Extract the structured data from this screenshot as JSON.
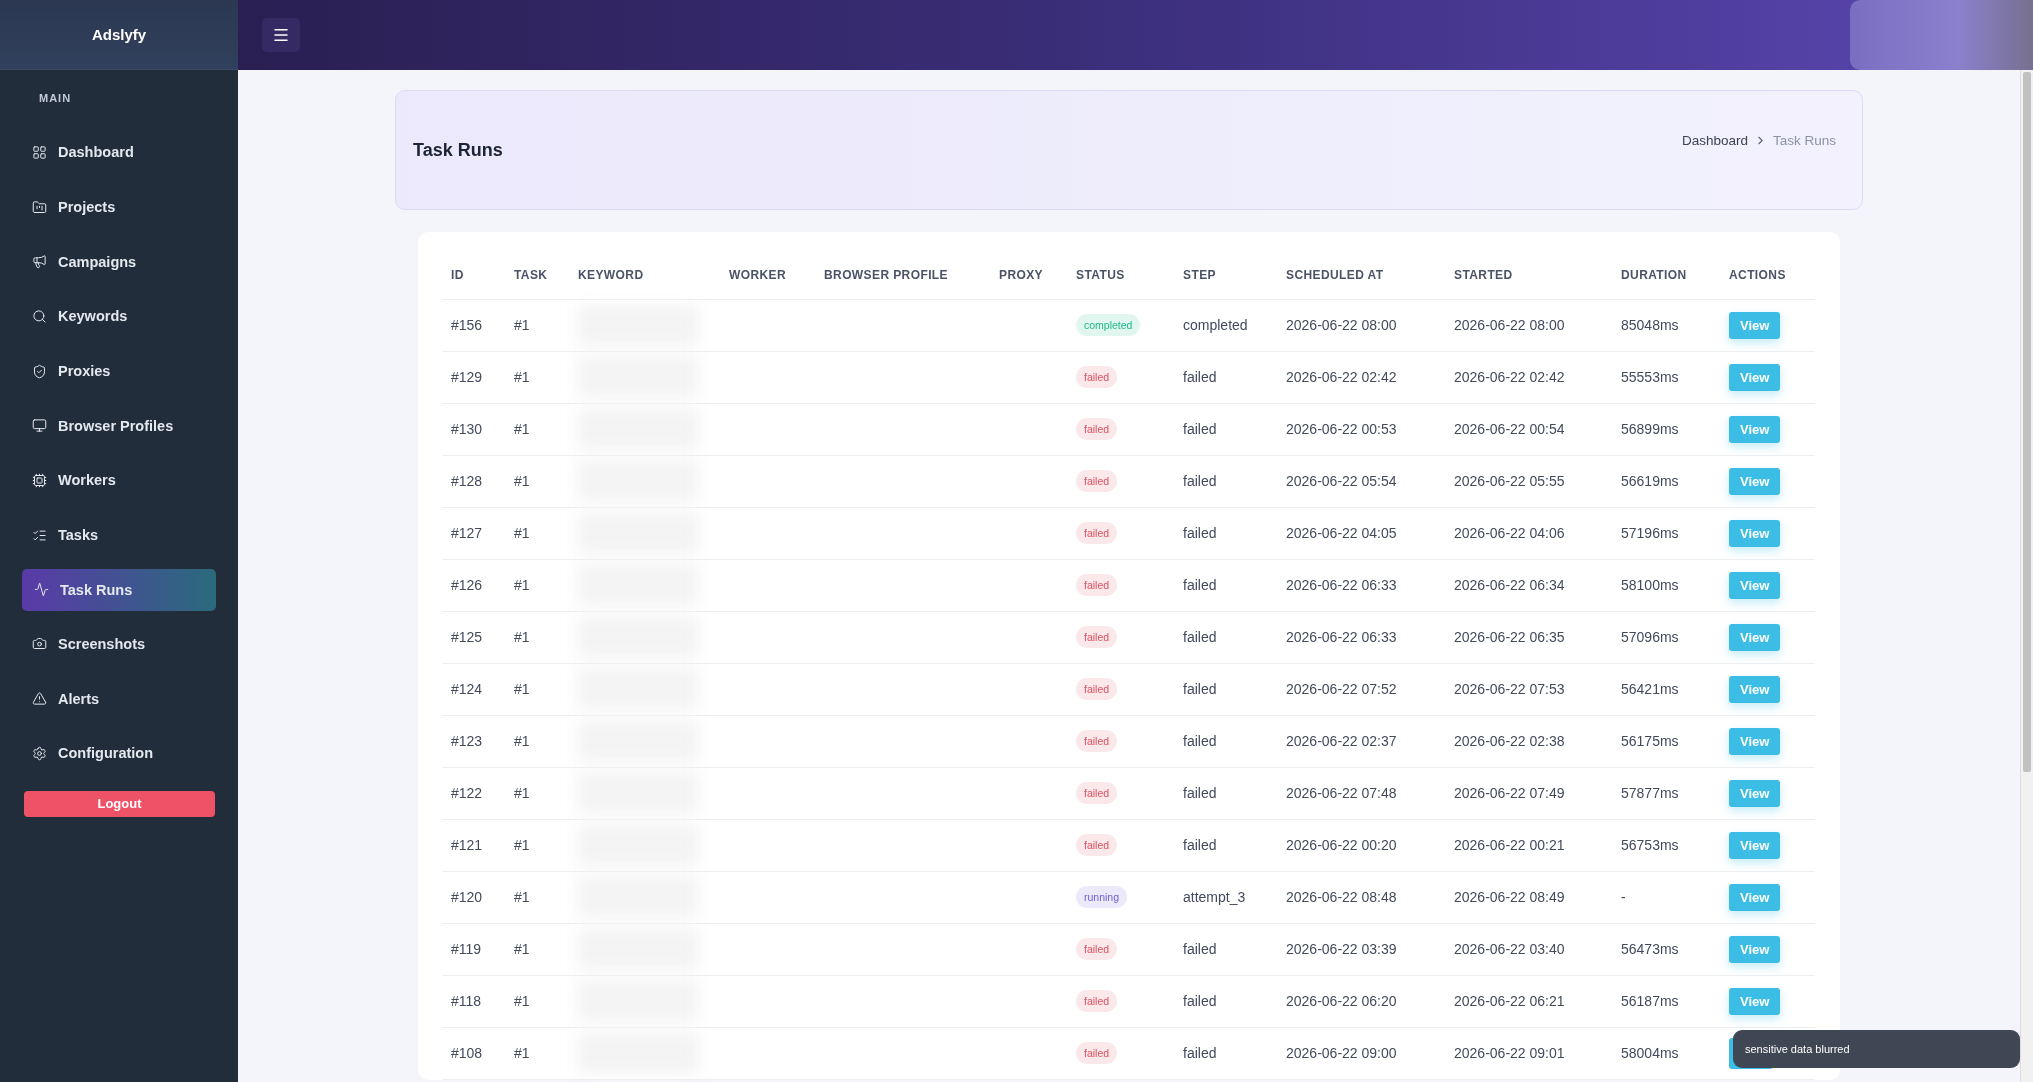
{
  "sidebar": {
    "brand": "Adslyfy",
    "section": "MAIN",
    "items": [
      {
        "label": "Dashboard",
        "selected": false
      },
      {
        "label": "Projects",
        "selected": false
      },
      {
        "label": "Campaigns",
        "selected": false
      },
      {
        "label": "Keywords",
        "selected": false
      },
      {
        "label": "Proxies",
        "selected": false
      },
      {
        "label": "Browser Profiles",
        "selected": false
      },
      {
        "label": "Workers",
        "selected": false
      },
      {
        "label": "Tasks",
        "selected": false
      },
      {
        "label": "Task Runs",
        "selected": true
      },
      {
        "label": "Screenshots",
        "selected": false
      },
      {
        "label": "Alerts",
        "selected": false
      },
      {
        "label": "Configuration",
        "selected": false
      }
    ],
    "logout": "Logout"
  },
  "page_header": {
    "title": "Task Runs",
    "breadcrumb": [
      "Dashboard",
      "Task Runs"
    ]
  },
  "table": {
    "columns": [
      "ID",
      "TASK",
      "KEYWORD",
      "WORKER",
      "BROWSER PROFILE",
      "PROXY",
      "STATUS",
      "STEP",
      "SCHEDULED AT",
      "STARTED",
      "DURATION",
      "ACTIONS"
    ],
    "rows": [
      {
        "id": "#156",
        "task": "#1",
        "status": {
          "label": "completed",
          "kind": "success"
        },
        "step": "completed",
        "scheduled_at": "2026-06-22 08:00",
        "started": "2026-06-22 08:00",
        "duration": "85048ms",
        "action": "View"
      },
      {
        "id": "#129",
        "task": "#1",
        "status": {
          "label": "failed",
          "kind": "error"
        },
        "step": "failed",
        "scheduled_at": "2026-06-22 02:42",
        "started": "2026-06-22 02:42",
        "duration": "55553ms",
        "action": "View"
      },
      {
        "id": "#130",
        "task": "#1",
        "status": {
          "label": "failed",
          "kind": "error"
        },
        "step": "failed",
        "scheduled_at": "2026-06-22 00:53",
        "started": "2026-06-22 00:54",
        "duration": "56899ms",
        "action": "View"
      },
      {
        "id": "#128",
        "task": "#1",
        "status": {
          "label": "failed",
          "kind": "error"
        },
        "step": "failed",
        "scheduled_at": "2026-06-22 05:54",
        "started": "2026-06-22 05:55",
        "duration": "56619ms",
        "action": "View"
      },
      {
        "id": "#127",
        "task": "#1",
        "status": {
          "label": "failed",
          "kind": "error"
        },
        "step": "failed",
        "scheduled_at": "2026-06-22 04:05",
        "started": "2026-06-22 04:06",
        "duration": "57196ms",
        "action": "View"
      },
      {
        "id": "#126",
        "task": "#1",
        "status": {
          "label": "failed",
          "kind": "error"
        },
        "step": "failed",
        "scheduled_at": "2026-06-22 06:33",
        "started": "2026-06-22 06:34",
        "duration": "58100ms",
        "action": "View"
      },
      {
        "id": "#125",
        "task": "#1",
        "status": {
          "label": "failed",
          "kind": "error"
        },
        "step": "failed",
        "scheduled_at": "2026-06-22 06:33",
        "started": "2026-06-22 06:35",
        "duration": "57096ms",
        "action": "View"
      },
      {
        "id": "#124",
        "task": "#1",
        "status": {
          "label": "failed",
          "kind": "error"
        },
        "step": "failed",
        "scheduled_at": "2026-06-22 07:52",
        "started": "2026-06-22 07:53",
        "duration": "56421ms",
        "action": "View"
      },
      {
        "id": "#123",
        "task": "#1",
        "status": {
          "label": "failed",
          "kind": "error"
        },
        "step": "failed",
        "scheduled_at": "2026-06-22 02:37",
        "started": "2026-06-22 02:38",
        "duration": "56175ms",
        "action": "View"
      },
      {
        "id": "#122",
        "task": "#1",
        "status": {
          "label": "failed",
          "kind": "error"
        },
        "step": "failed",
        "scheduled_at": "2026-06-22 07:48",
        "started": "2026-06-22 07:49",
        "duration": "57877ms",
        "action": "View"
      },
      {
        "id": "#121",
        "task": "#1",
        "status": {
          "label": "failed",
          "kind": "error"
        },
        "step": "failed",
        "scheduled_at": "2026-06-22 00:20",
        "started": "2026-06-22 00:21",
        "duration": "56753ms",
        "action": "View"
      },
      {
        "id": "#120",
        "task": "#1",
        "status": {
          "label": "running",
          "kind": "active"
        },
        "step": "attempt_3",
        "scheduled_at": "2026-06-22 08:48",
        "started": "2026-06-22 08:49",
        "duration": "-",
        "action": "View"
      },
      {
        "id": "#119",
        "task": "#1",
        "status": {
          "label": "failed",
          "kind": "error"
        },
        "step": "failed",
        "scheduled_at": "2026-06-22 03:39",
        "started": "2026-06-22 03:40",
        "duration": "56473ms",
        "action": "View"
      },
      {
        "id": "#118",
        "task": "#1",
        "status": {
          "label": "failed",
          "kind": "error"
        },
        "step": "failed",
        "scheduled_at": "2026-06-22 06:20",
        "started": "2026-06-22 06:21",
        "duration": "56187ms",
        "action": "View"
      },
      {
        "id": "#108",
        "task": "#1",
        "status": {
          "label": "failed",
          "kind": "error"
        },
        "step": "failed",
        "scheduled_at": "2026-06-22 09:00",
        "started": "2026-06-22 09:01",
        "duration": "58004ms"
      }
    ]
  },
  "toast": "sensitive data blurred"
}
